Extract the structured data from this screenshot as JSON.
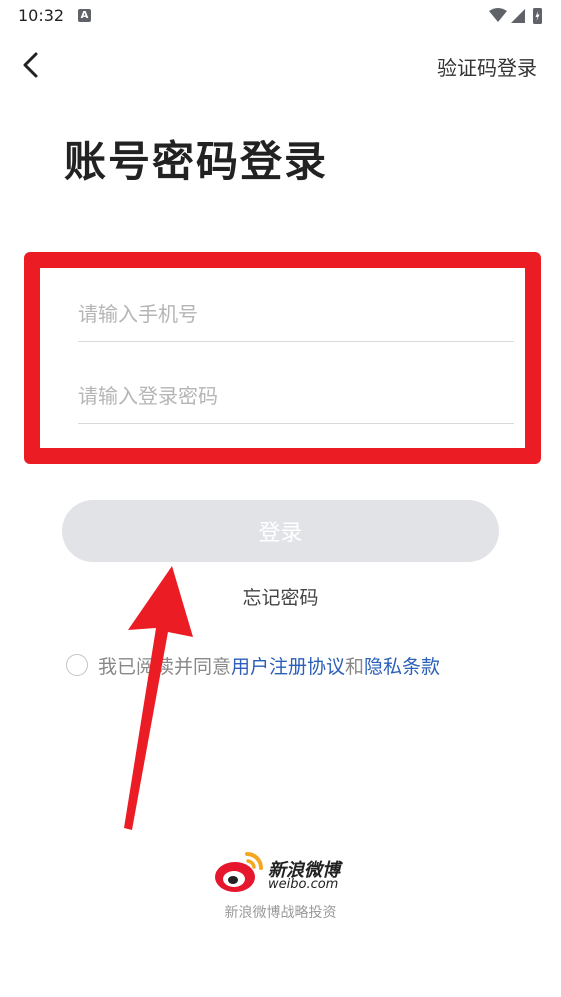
{
  "status_bar": {
    "time": "10:32",
    "notif_letter": "A"
  },
  "nav": {
    "sms_login_label": "验证码登录"
  },
  "page": {
    "title": "账号密码登录"
  },
  "form": {
    "phone_placeholder": "请输入手机号",
    "password_placeholder": "请输入登录密码",
    "highlight_color": "#ec1c24"
  },
  "actions": {
    "login_label": "登录",
    "forgot_label": "忘记密码"
  },
  "agreement": {
    "prefix": "我已阅读并同意",
    "terms_link": "用户注册协议",
    "joiner": "和",
    "privacy_link": "隐私条款",
    "link_color": "#2b5fb8"
  },
  "footer": {
    "brand_name": "新浪微博",
    "brand_domain": "weibo.com",
    "note": "新浪微博战略投资"
  },
  "icons": [
    "back-arrow-icon",
    "wifi-icon",
    "signal-icon",
    "battery-icon",
    "weibo-logo-icon",
    "annotation-arrow"
  ]
}
